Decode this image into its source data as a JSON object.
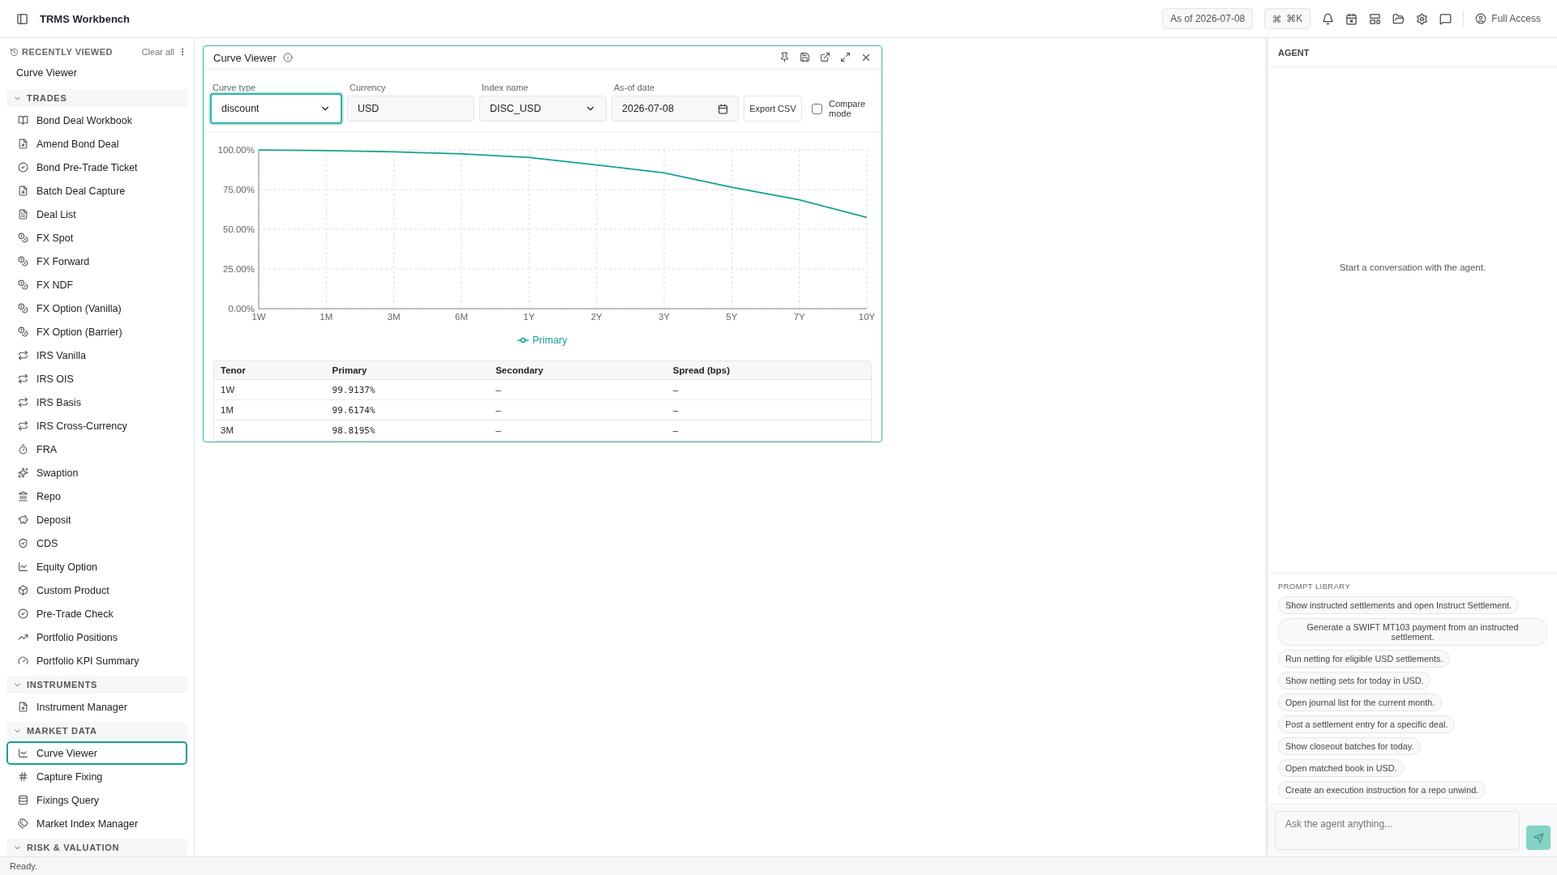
{
  "topbar": {
    "title": "TRMS Workbench",
    "as_of": "As of 2026-07-08",
    "shortcut": "⌘K",
    "access": "Full Access"
  },
  "sidebar": {
    "recent": {
      "title": "RECENTLY VIEWED",
      "clear": "Clear all",
      "items": [
        "Curve Viewer"
      ]
    },
    "sections": [
      {
        "title": "TRADES",
        "expanded": true,
        "items": [
          {
            "label": "Bond Deal Workbook",
            "selected": false
          },
          {
            "label": "Amend Bond Deal",
            "selected": false
          },
          {
            "label": "Bond Pre-Trade Ticket",
            "selected": false
          },
          {
            "label": "Batch Deal Capture",
            "selected": false
          },
          {
            "label": "Deal List",
            "selected": false
          },
          {
            "label": "FX Spot",
            "selected": false
          },
          {
            "label": "FX Forward",
            "selected": false
          },
          {
            "label": "FX NDF",
            "selected": false
          },
          {
            "label": "FX Option (Vanilla)",
            "selected": false
          },
          {
            "label": "FX Option (Barrier)",
            "selected": false
          },
          {
            "label": "IRS Vanilla",
            "selected": false
          },
          {
            "label": "IRS OIS",
            "selected": false
          },
          {
            "label": "IRS Basis",
            "selected": false
          },
          {
            "label": "IRS Cross-Currency",
            "selected": false
          },
          {
            "label": "FRA",
            "selected": false
          },
          {
            "label": "Swaption",
            "selected": false
          },
          {
            "label": "Repo",
            "selected": false
          },
          {
            "label": "Deposit",
            "selected": false
          },
          {
            "label": "CDS",
            "selected": false
          },
          {
            "label": "Equity Option",
            "selected": false
          },
          {
            "label": "Custom Product",
            "selected": false
          },
          {
            "label": "Pre-Trade Check",
            "selected": false
          },
          {
            "label": "Portfolio Positions",
            "selected": false
          },
          {
            "label": "Portfolio KPI Summary",
            "selected": false
          }
        ]
      },
      {
        "title": "INSTRUMENTS",
        "expanded": true,
        "items": [
          {
            "label": "Instrument Manager",
            "selected": false
          }
        ]
      },
      {
        "title": "MARKET DATA",
        "expanded": true,
        "items": [
          {
            "label": "Curve Viewer",
            "selected": true
          },
          {
            "label": "Capture Fixing",
            "selected": false
          },
          {
            "label": "Fixings Query",
            "selected": false
          },
          {
            "label": "Market Index Manager",
            "selected": false
          }
        ]
      },
      {
        "title": "RISK & VALUATION",
        "expanded": true
      }
    ]
  },
  "curve_viewer": {
    "title": "Curve Viewer",
    "filters": [
      {
        "kind": "select",
        "label": "Curve type",
        "value": "discount",
        "focused": true
      },
      {
        "kind": "text",
        "label": "Currency",
        "value": "USD",
        "focused": false
      },
      {
        "kind": "select",
        "label": "Index name",
        "value": "DISC_USD",
        "focused": false
      },
      {
        "kind": "date",
        "label": "As-of date",
        "value": "2026-07-08",
        "focused": false
      }
    ],
    "export_button": "Export CSV",
    "compare": {
      "label": "Compare mode",
      "checked": false
    },
    "chart_data": {
      "type": "line",
      "grid": true,
      "categories": [
        "1W",
        "1M",
        "3M",
        "6M",
        "1Y",
        "2Y",
        "3Y",
        "5Y",
        "7Y",
        "10Y"
      ],
      "series": [
        {
          "name": "Primary",
          "color": "#14a192",
          "values": [
            99.9,
            99.6,
            98.8,
            97.5,
            95.2,
            90.5,
            85.5,
            76.5,
            68.5,
            57.5
          ]
        }
      ],
      "ylim": [
        0,
        100
      ],
      "yticks": [
        {
          "value": 0,
          "label": "0.00%"
        },
        {
          "value": 25,
          "label": "25.00%"
        },
        {
          "value": 50,
          "label": "50.00%"
        },
        {
          "value": 75,
          "label": "75.00%"
        },
        {
          "value": 100,
          "label": "100.00%"
        }
      ]
    },
    "table": {
      "columns": [
        "Tenor",
        "Primary",
        "Secondary",
        "Spread (bps)"
      ],
      "rows": [
        [
          "1W",
          "99.9137%",
          "–",
          "–"
        ],
        [
          "1M",
          "99.6174%",
          "–",
          "–"
        ],
        [
          "3M",
          "98.8195%",
          "–",
          "–"
        ]
      ]
    }
  },
  "agent": {
    "title": "AGENT",
    "empty": "Start a conversation with the agent.",
    "library_title": "PROMPT LIBRARY",
    "prompts": [
      "Show instructed settlements and open Instruct Settlement.",
      "Generate a SWIFT MT103 payment from an instructed settlement.",
      "Run netting for eligible USD settlements.",
      "Show netting sets for today in USD.",
      "Open journal list for the current month.",
      "Post a settlement entry for a specific deal.",
      "Show closeout batches for today.",
      "Open matched book in USD.",
      "Create an execution instruction for a repo unwind."
    ],
    "input": {
      "placeholder": "Ask the agent anything..."
    },
    "send_disabled": true
  },
  "status_bar": "Ready."
}
